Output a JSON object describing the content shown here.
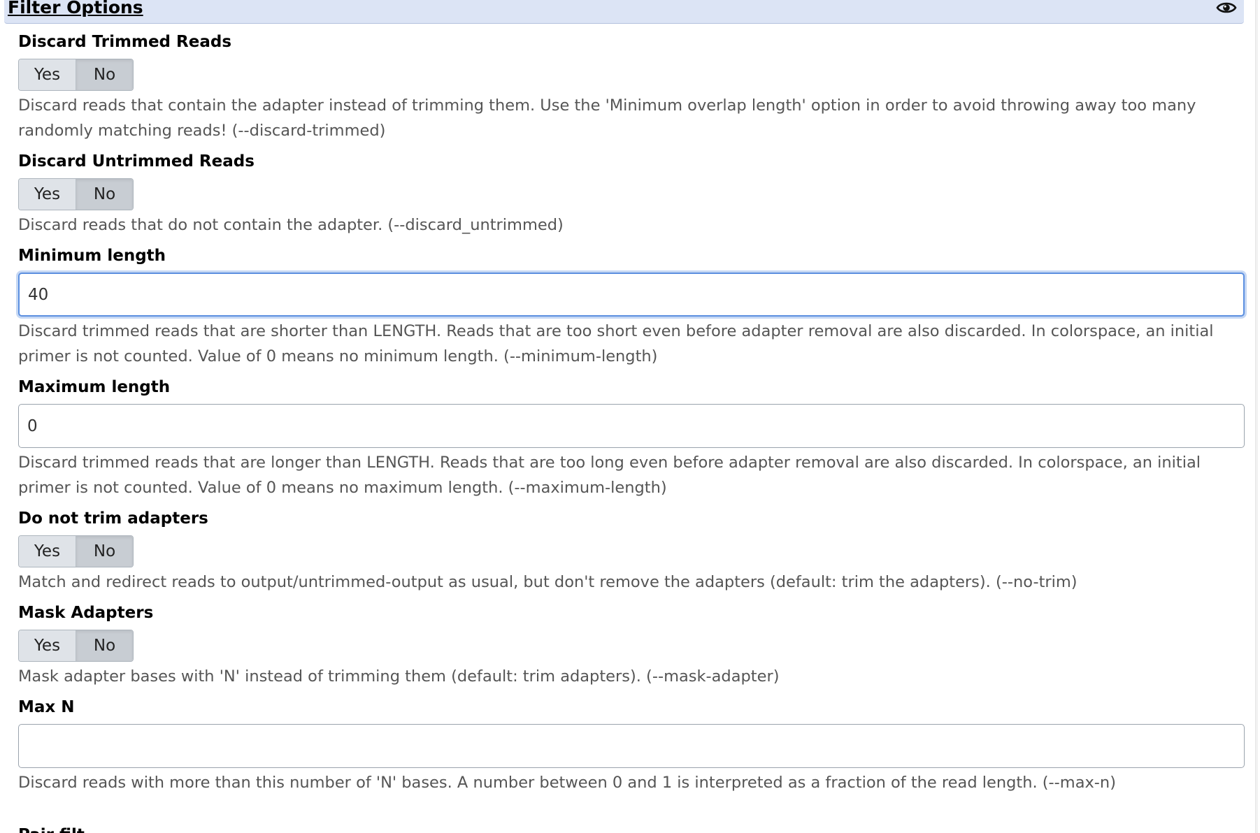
{
  "section": {
    "title": "Filter Options",
    "icon": "eye-icon"
  },
  "fields": {
    "discard_trimmed": {
      "label": "Discard Trimmed Reads",
      "yes": "Yes",
      "no": "No",
      "selected": "No",
      "help": "Discard reads that contain the adapter instead of trimming them. Use the 'Minimum overlap length' option in order to avoid throwing away too many randomly matching reads! (--discard-trimmed)"
    },
    "discard_untrimmed": {
      "label": "Discard Untrimmed Reads",
      "yes": "Yes",
      "no": "No",
      "selected": "No",
      "help": "Discard reads that do not contain the adapter. (--discard_untrimmed)"
    },
    "minimum_length": {
      "label": "Minimum length",
      "value": "40",
      "help": "Discard trimmed reads that are shorter than LENGTH. Reads that are too short even before adapter removal are also discarded. In colorspace, an initial primer is not counted. Value of 0 means no minimum length. (--minimum-length)"
    },
    "maximum_length": {
      "label": "Maximum length",
      "value": "0",
      "help": "Discard trimmed reads that are longer than LENGTH. Reads that are too long even before adapter removal are also discarded. In colorspace, an initial primer is not counted. Value of 0 means no maximum length. (--maximum-length)"
    },
    "no_trim": {
      "label": "Do not trim adapters",
      "yes": "Yes",
      "no": "No",
      "selected": "No",
      "help": "Match and redirect reads to output/untrimmed-output as usual, but don't remove the adapters (default: trim the adapters). (--no-trim)"
    },
    "mask_adapters": {
      "label": "Mask Adapters",
      "yes": "Yes",
      "no": "No",
      "selected": "No",
      "help": "Mask adapter bases with 'N' instead of trimming them (default: trim adapters). (--mask-adapter)"
    },
    "max_n": {
      "label": "Max N",
      "value": "",
      "help": "Discard reads with more than this number of 'N' bases. A number between 0 and 1 is interpreted as a fraction of the read length. (--max-n)"
    },
    "next_label_partial": "Pair filt"
  }
}
